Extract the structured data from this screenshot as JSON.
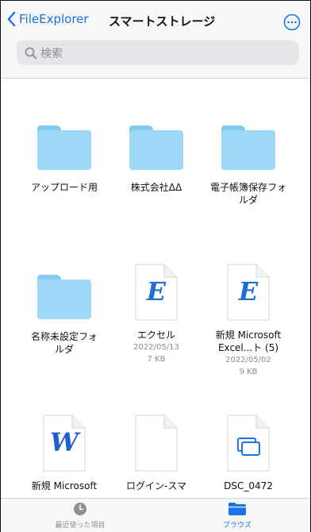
{
  "header": {
    "back_label": "FileExplorer",
    "title": "スマートストレージ",
    "search_placeholder": "検索"
  },
  "items": [
    {
      "name": "アップロード用",
      "type": "folder"
    },
    {
      "name": "株式会社ΔΔ",
      "type": "folder"
    },
    {
      "name": "電子帳簿保存フォルダ",
      "type": "folder"
    },
    {
      "name": "名称未設定フォルダ",
      "type": "folder"
    },
    {
      "name": "エクセル",
      "type": "excel",
      "date": "2022/05/13",
      "size": "7 KB"
    },
    {
      "name": "新規 Microsoft Excel...ト (5)",
      "type": "excel",
      "date": "2022/05/02",
      "size": "9 KB"
    },
    {
      "name": "新規 Microsoft",
      "type": "word"
    },
    {
      "name": "ログイン-スマ",
      "type": "blank"
    },
    {
      "name": "DSC_0472",
      "type": "image"
    }
  ],
  "icons": {
    "excel_letter": "E",
    "word_letter": "W"
  },
  "tabbar": {
    "recent_label": "最近使った項目",
    "browse_label": "ブラウズ"
  },
  "colors": {
    "accent": "#1a73e8",
    "folder": "#9fd8f7",
    "excel": "#1f6fd6",
    "word": "#1f5fd1"
  }
}
